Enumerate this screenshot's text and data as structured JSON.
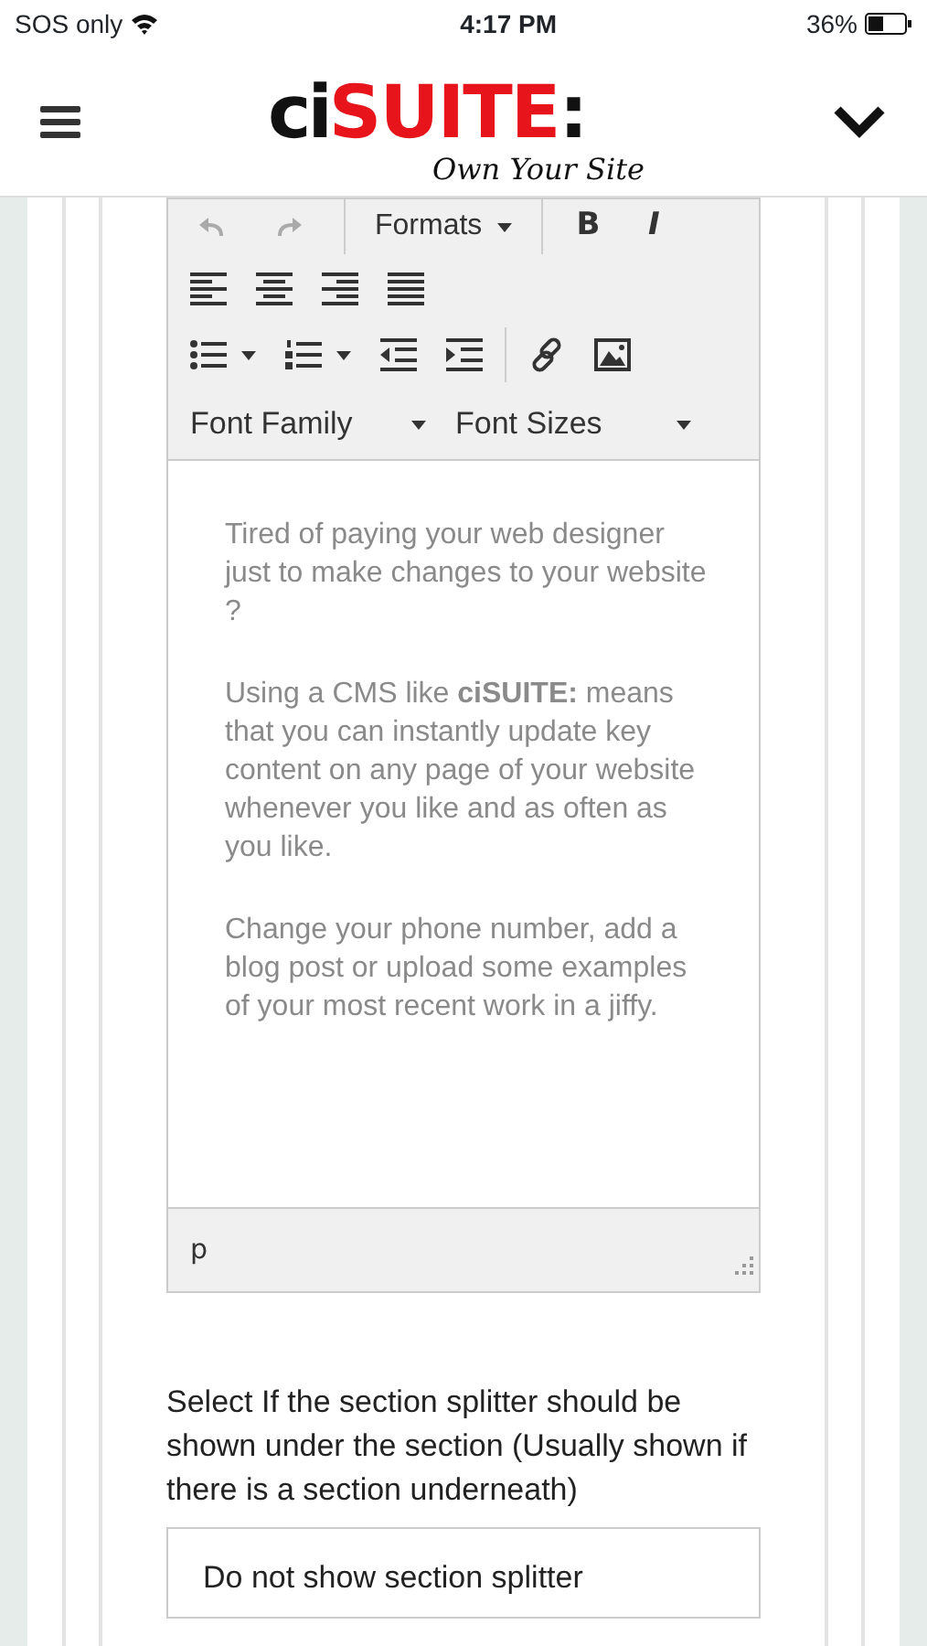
{
  "status_bar": {
    "carrier": "SOS only",
    "time": "4:17 PM",
    "battery": "36%"
  },
  "header": {
    "logo_prefix": "ci",
    "logo_main": "SUITE",
    "logo_suffix": ":",
    "tagline": "Own Your Site"
  },
  "editor": {
    "toolbar_partial": [
      {
        "kind": "undo"
      },
      {
        "kind": "redo"
      },
      {
        "kind": "dropdown",
        "label": "Formats"
      },
      {
        "kind": "bold",
        "label": "B"
      },
      {
        "kind": "italic",
        "label": "I"
      }
    ],
    "align_buttons": [
      {
        "kind": "left"
      },
      {
        "kind": "center"
      },
      {
        "kind": "right"
      },
      {
        "kind": "justify"
      }
    ],
    "list_buttons": [
      {
        "kind": "bullets",
        "caret": true
      },
      {
        "kind": "numbers",
        "caret": true
      },
      {
        "kind": "outdent",
        "caret": false
      },
      {
        "kind": "indent",
        "caret": false
      }
    ],
    "insert_buttons": [
      {
        "kind": "link"
      },
      {
        "kind": "image"
      }
    ],
    "dropdowns": [
      {
        "label": "Font Family"
      },
      {
        "label": "Font Sizes"
      }
    ],
    "paragraphs": [
      "Tired of paying your web designer just to make changes to your website ?",
      "Using a CMS like **ciSUITE:** means that you can instantly update key content on any page of your website whenever you like and as often as you like.",
      "Change your phone number, add a blog post or upload some examples of your most recent work in a jiffy."
    ],
    "path": "p"
  },
  "splitter": {
    "label": "Select If the section splitter should be shown under the section (Usually shown if there is a section underneath)",
    "value": "Do not show section splitter"
  }
}
